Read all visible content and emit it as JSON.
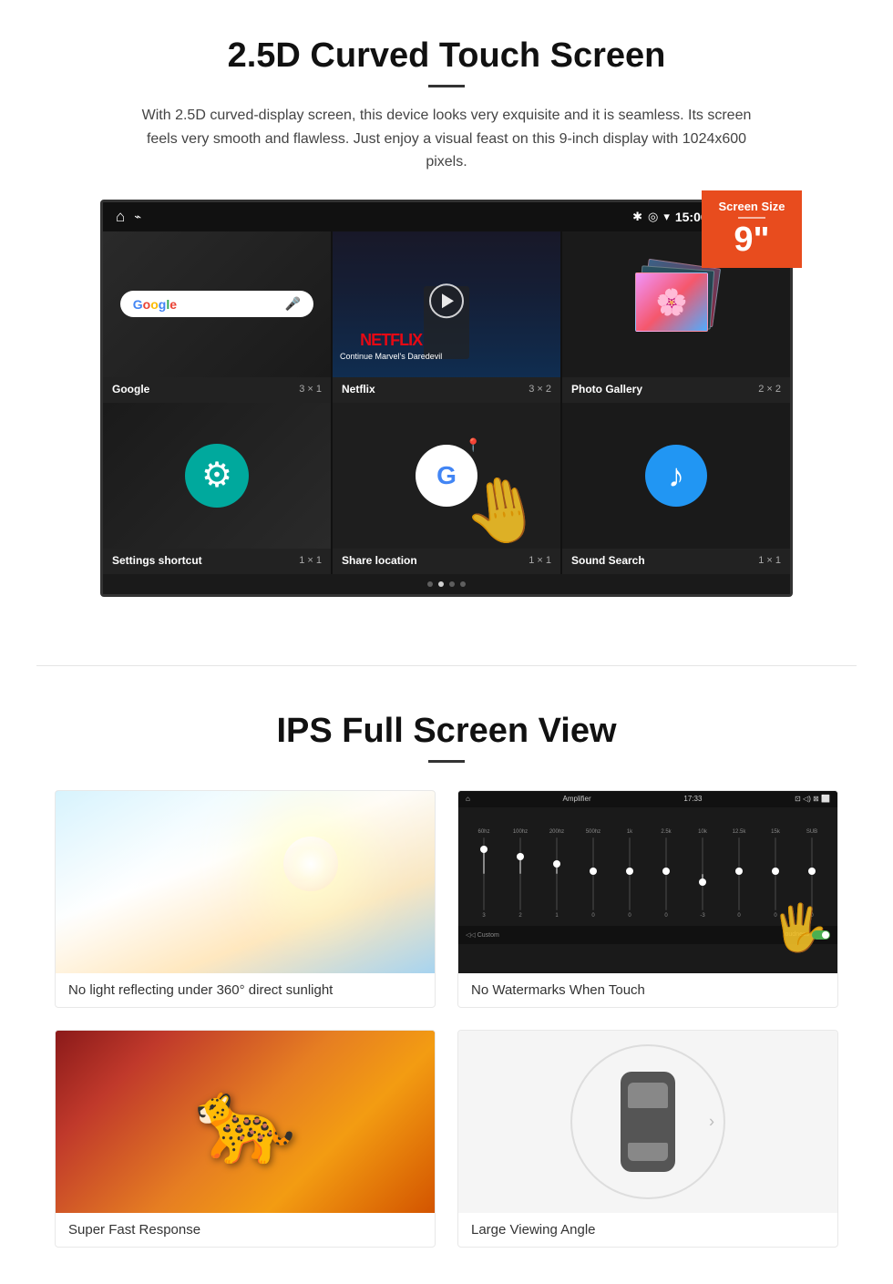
{
  "section1": {
    "title": "2.5D Curved Touch Screen",
    "description": "With 2.5D curved-display screen, this device looks very exquisite and it is seamless. Its screen feels very smooth and flawless. Just enjoy a visual feast on this 9-inch display with 1024x600 pixels.",
    "screen_badge": {
      "label": "Screen Size",
      "size": "9\""
    },
    "status_bar": {
      "time": "15:06",
      "icons": [
        "bluetooth",
        "location",
        "wifi",
        "camera",
        "volume",
        "close",
        "square"
      ]
    },
    "apps_row1": [
      {
        "name": "Google",
        "size": "3 × 1",
        "type": "google"
      },
      {
        "name": "Netflix",
        "size": "3 × 2",
        "type": "netflix",
        "netflix_text": "NETFLIX",
        "netflix_subtitle": "Continue Marvel's Daredevil"
      },
      {
        "name": "Photo Gallery",
        "size": "2 × 2",
        "type": "gallery"
      }
    ],
    "apps_row2": [
      {
        "name": "Settings shortcut",
        "size": "1 × 1",
        "type": "settings"
      },
      {
        "name": "Share location",
        "size": "1 × 1",
        "type": "share_location"
      },
      {
        "name": "Sound Search",
        "size": "1 × 1",
        "type": "sound_search"
      }
    ]
  },
  "section2": {
    "title": "IPS Full Screen View",
    "features": [
      {
        "id": "sunlight",
        "caption": "No light reflecting under 360° direct sunlight"
      },
      {
        "id": "amplifier",
        "caption": "No Watermarks When Touch"
      },
      {
        "id": "cheetah",
        "caption": "Super Fast Response"
      },
      {
        "id": "car",
        "caption": "Large Viewing Angle"
      }
    ]
  }
}
